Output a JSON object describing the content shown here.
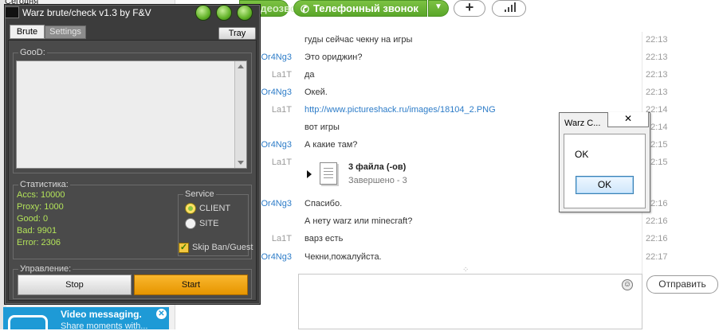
{
  "skype": {
    "sidebar_heading": "Сегодня",
    "video_btn": "Видеозвонок",
    "call_btn": "Телефонный звонок",
    "send_btn": "Отправить",
    "file": {
      "title": "3 файла (-ов)",
      "status": "Завершено - 3"
    },
    "promo": {
      "title": "Video messaging.",
      "subtitle": "Share moments with..."
    },
    "messages": [
      {
        "name": "",
        "text": "гуды сейчас чекну на игры",
        "time": "22:13"
      },
      {
        "name": "Or4Ng3",
        "text": "Это ориджин?",
        "time": "22:13"
      },
      {
        "name": "La1T",
        "text": "да",
        "time": "22:13"
      },
      {
        "name": "Or4Ng3",
        "text": "Окей.",
        "time": "22:13"
      },
      {
        "name": "La1T",
        "text": "http://www.pictureshack.ru/images/18104_2.PNG",
        "time": "22:14"
      },
      {
        "name": "",
        "text": "вот игры",
        "time": "22:14"
      },
      {
        "name": "Or4Ng3",
        "text": "А какие там?",
        "time": "22:15"
      },
      {
        "name": "La1T",
        "text": "",
        "time": "22:15"
      },
      {
        "name": "Or4Ng3",
        "text": "Спасибо.",
        "time": "22:16"
      },
      {
        "name": "",
        "text": "А нету warz или minecraft?",
        "time": "22:16"
      },
      {
        "name": "La1T",
        "text": "варз есть",
        "time": "22:16"
      },
      {
        "name": "Or4Ng3",
        "text": "Чекни,пожалуйста.",
        "time": "22:17"
      }
    ]
  },
  "warz": {
    "title": "Warz brute/check v1.3 by F&V",
    "tab_brute": "Brute",
    "tab_settings": "Settings",
    "tray": "Tray",
    "good_label": "GooD:",
    "stats_label": "Статистика:",
    "stats": {
      "accs": "Accs: 10000",
      "proxy": "Proxy: 1000",
      "good": "Good: 0",
      "bad": "Bad: 9901",
      "error": "Error: 2306"
    },
    "service_label": "Service",
    "client": "CLIENT",
    "site": "SITE",
    "skip": "Skip Ban/Guest",
    "control_label": "Управление:",
    "stop": "Stop",
    "start": "Start"
  },
  "msgbox": {
    "title": "Warz C...",
    "close": "✕",
    "text": "OK",
    "ok": "OK"
  },
  "colors": {
    "accent_green": "#5aa62a",
    "stat_green": "#b3e35a",
    "start_orange": "#e69500",
    "link_blue": "#2d7cc8"
  }
}
